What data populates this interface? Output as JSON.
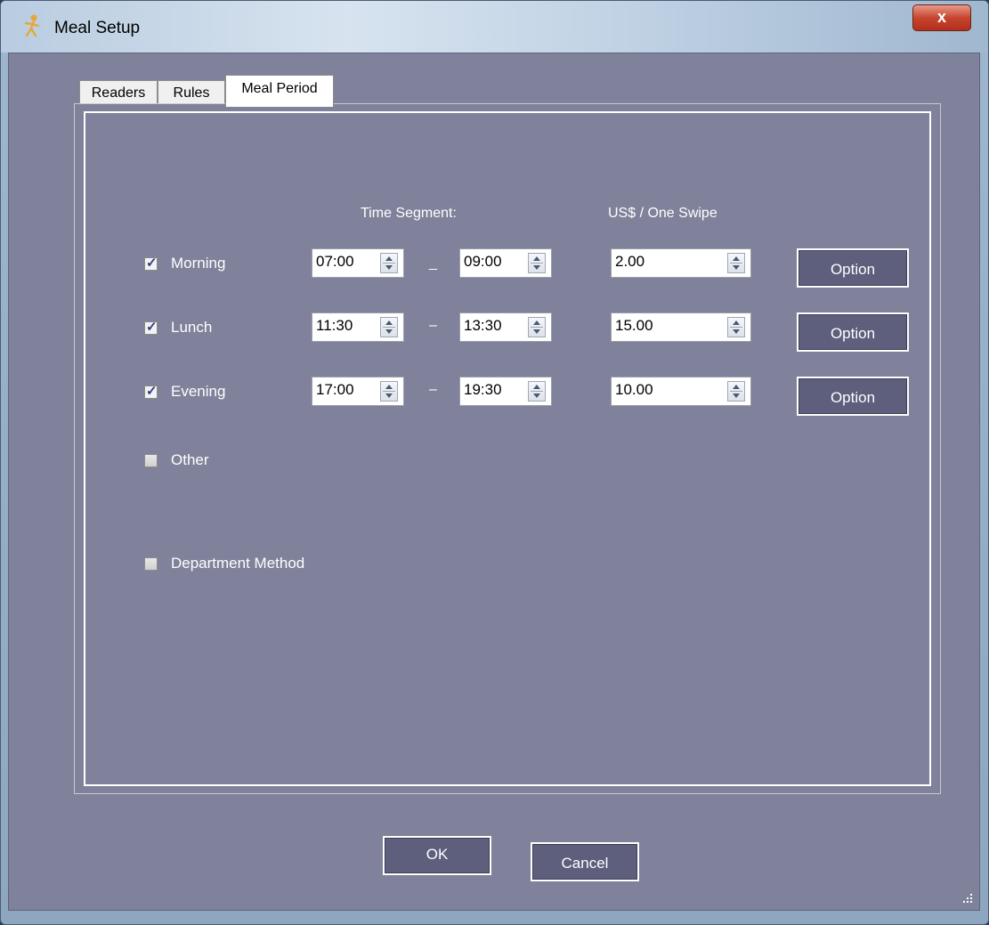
{
  "window": {
    "title": "Meal Setup",
    "close_label": "x",
    "app_icon": "key-person-icon"
  },
  "tabs": [
    {
      "label": "Readers",
      "active": false
    },
    {
      "label": "Rules",
      "active": false
    },
    {
      "label": "Meal Period",
      "active": true
    }
  ],
  "headers": {
    "time_segment": "Time Segment:",
    "price": "US$ / One Swipe"
  },
  "rows": [
    {
      "label": "Morning",
      "checked": true,
      "start": "07:00",
      "separator": "_",
      "end": "09:00",
      "price": "2.00",
      "option_label": "Option"
    },
    {
      "label": "Lunch",
      "checked": true,
      "start": "11:30",
      "separator": "–",
      "end": "13:30",
      "price": "15.00",
      "option_label": "Option"
    },
    {
      "label": "Evening",
      "checked": true,
      "start": "17:00",
      "separator": "–",
      "end": "19:30",
      "price": "10.00",
      "option_label": "Option"
    }
  ],
  "other": {
    "label": "Other",
    "checked": false
  },
  "department_method": {
    "label": "Department Method",
    "checked": false
  },
  "buttons": {
    "ok_label": "OK",
    "cancel_label": "Cancel"
  },
  "colors": {
    "panel_bg": "#7f829a",
    "button_bg": "#5d5f7d",
    "close_red": "#c7452f"
  }
}
